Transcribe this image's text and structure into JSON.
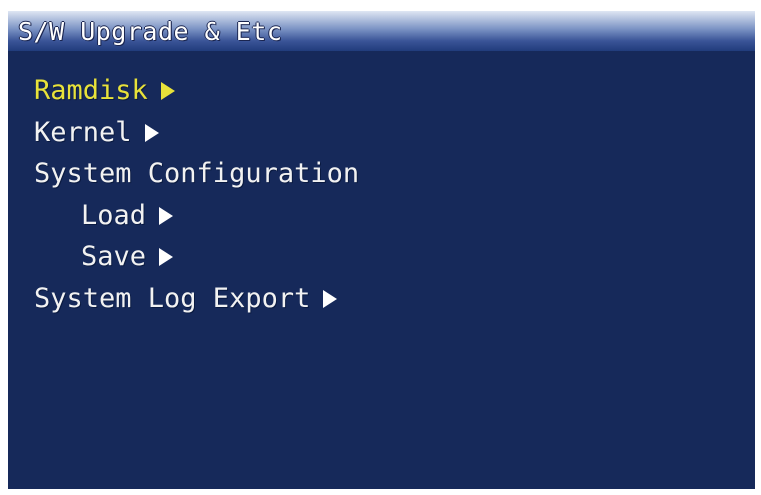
{
  "window": {
    "title": "S/W Upgrade & Etc"
  },
  "menu": {
    "items": [
      {
        "label": "Ramdisk",
        "has_arrow": true,
        "selected": true
      },
      {
        "label": "Kernel",
        "has_arrow": true,
        "selected": false
      },
      {
        "label": "System Configuration",
        "has_arrow": false,
        "selected": false
      },
      {
        "label": "Load",
        "has_arrow": true,
        "selected": false
      },
      {
        "label": "Save",
        "has_arrow": true,
        "selected": false
      },
      {
        "label": "System Log Export",
        "has_arrow": true,
        "selected": false
      }
    ]
  },
  "colors": {
    "background": "#16295a",
    "text": "#f2f2f2",
    "highlight": "#e8e23a"
  }
}
